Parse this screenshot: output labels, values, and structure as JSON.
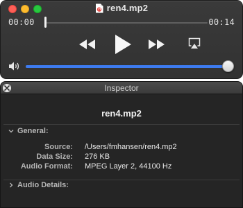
{
  "player": {
    "title": "ren4.mp2",
    "time_elapsed": "00:00",
    "time_total": "00:14",
    "playback_progress": 0.0,
    "volume_level": 0.98,
    "accent_color": "#3d7bf0",
    "icons": {
      "file": "audio-file-icon",
      "rewind": "rewind-icon",
      "play": "play-icon",
      "fast_forward": "fast-forward-icon",
      "airplay": "airplay-icon",
      "volume": "speaker-volume-icon"
    }
  },
  "inspector": {
    "window_title": "Inspector",
    "file_name": "ren4.mp2",
    "general_section": {
      "label": "General:",
      "expanded": true,
      "rows": [
        {
          "label": "Source:",
          "value": "/Users/fmhansen/ren4.mp2"
        },
        {
          "label": "Data Size:",
          "value": "276 KB"
        },
        {
          "label": "Audio Format:",
          "value": "MPEG Layer 2, 44100 Hz"
        }
      ]
    },
    "audio_section": {
      "label": "Audio Details:",
      "expanded": false
    }
  }
}
